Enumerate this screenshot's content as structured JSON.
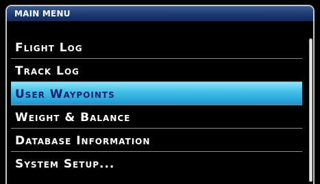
{
  "menu": {
    "title": "MAIN MENU",
    "items": [
      {
        "label": "Flight Log",
        "selected": false
      },
      {
        "label": "Track Log",
        "selected": false
      },
      {
        "label": "User Waypoints",
        "selected": true
      },
      {
        "label": "Weight & Balance",
        "selected": false
      },
      {
        "label": "Database Information",
        "selected": false
      },
      {
        "label": "System Setup...",
        "selected": false
      }
    ]
  },
  "colors": {
    "title_bar": "#1d3a72",
    "selection": "#3fbfe8",
    "selected_text": "#0a1f6e",
    "text": "#ffffff",
    "background": "#000000"
  }
}
